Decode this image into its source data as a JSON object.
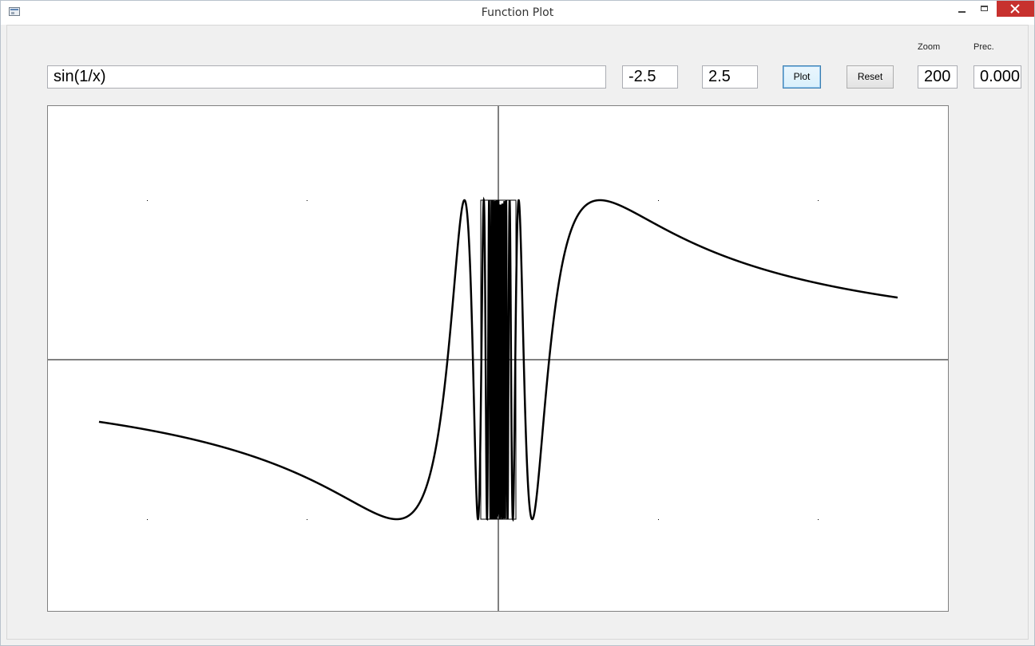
{
  "window": {
    "title": "Function Plot"
  },
  "controls": {
    "function_expression": "sin(1/x)",
    "x_min": "-2.5",
    "x_max": "2.5",
    "plot_label": "Plot",
    "reset_label": "Reset",
    "zoom_label": "Zoom",
    "zoom_value": "200",
    "precision_label": "Prec.",
    "precision_value": "0.000"
  },
  "plot": {
    "function": "sin(1/x)",
    "x_range": [
      -2.5,
      2.5
    ],
    "y_range": [
      -1,
      1
    ],
    "zoom": 200,
    "curve_color": "#000000",
    "axis_color": "#000000",
    "background_color": "#ffffff",
    "grid": "dot markers at ±1"
  },
  "colors": {
    "close_button": "#c7312e",
    "primary_button_border": "#3c7fb1"
  },
  "icons": {
    "app_icon": "window-icon",
    "minimize": "minimize-icon",
    "maximize": "maximize-icon",
    "close": "close-icon"
  }
}
